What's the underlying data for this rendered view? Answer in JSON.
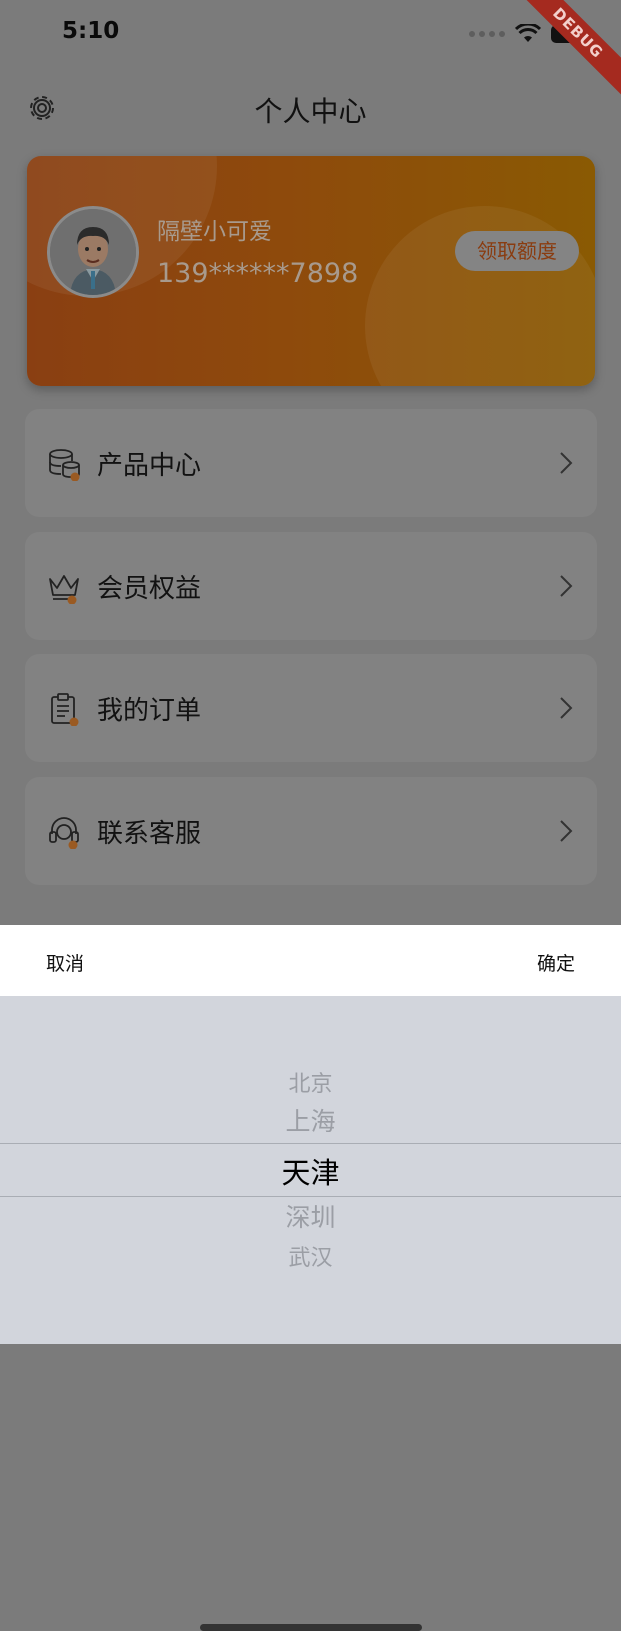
{
  "status_bar": {
    "time": "5:10"
  },
  "debug_banner": "DEBUG",
  "header": {
    "title": "个人中心"
  },
  "profile": {
    "name": "隔壁小可爱",
    "phone": "139******7898",
    "claim_button": "领取额度"
  },
  "menu": [
    {
      "label": "产品中心",
      "icon": "database-icon"
    },
    {
      "label": "会员权益",
      "icon": "crown-icon"
    },
    {
      "label": "我的订单",
      "icon": "clipboard-icon"
    },
    {
      "label": "联系客服",
      "icon": "headset-icon"
    }
  ],
  "picker": {
    "cancel_label": "取消",
    "confirm_label": "确定",
    "options": [
      "北京",
      "上海",
      "天津",
      "深圳",
      "武汉"
    ],
    "selected": "天津"
  },
  "colors": {
    "accent": "#e07a2f",
    "card_start": "#8a3f12",
    "card_end": "#8a5a03"
  }
}
